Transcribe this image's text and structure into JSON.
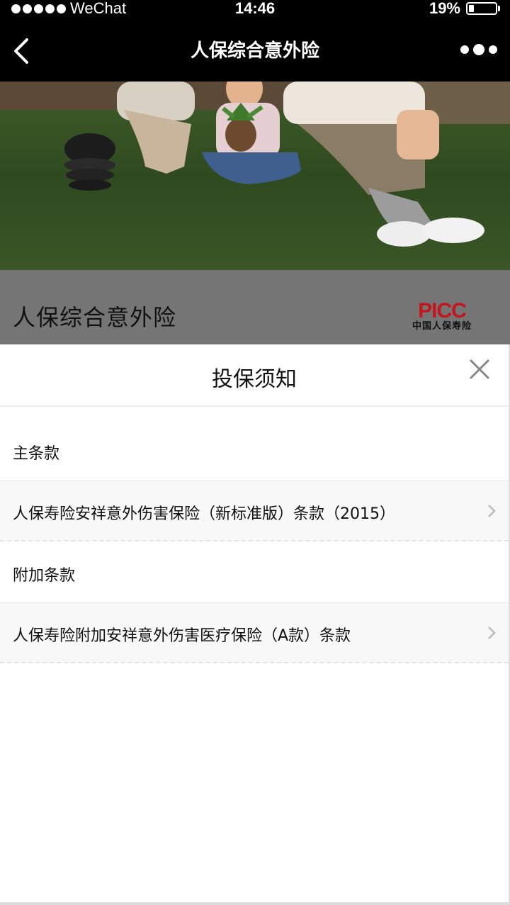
{
  "status_bar": {
    "carrier": "WeChat",
    "time": "14:46",
    "battery_percent": "19%",
    "battery_level": 0.19
  },
  "nav": {
    "title": "人保综合意外险"
  },
  "hero": {
    "product_title": "人保综合意外险",
    "logo_text": "PICC",
    "logo_subtext": "中国人保寿险"
  },
  "sheet": {
    "title": "投保须知",
    "main_section": "主条款",
    "main_items": [
      {
        "label": "人保寿险安祥意外伤害保险（新标准版）条款（2015）"
      }
    ],
    "addon_section": "附加条款",
    "addon_items": [
      {
        "label": "人保寿险附加安祥意外伤害医疗保险（A款）条款"
      }
    ]
  },
  "colors": {
    "brand_red": "#c4161c",
    "nav_background": "#000000"
  }
}
